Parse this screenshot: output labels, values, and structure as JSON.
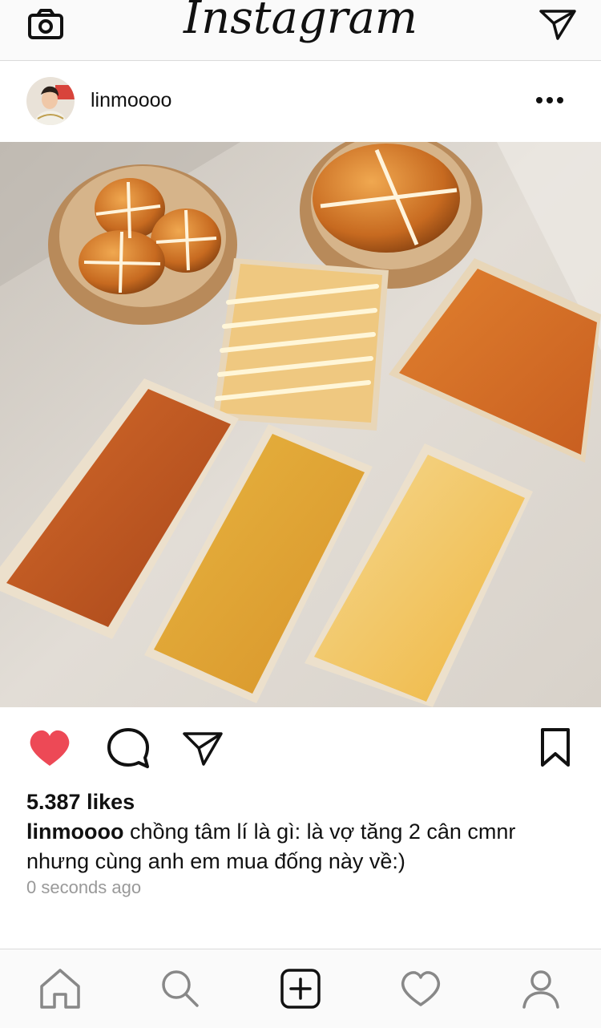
{
  "app": {
    "brand": "Instagram"
  },
  "icons": {
    "camera": "camera-icon",
    "direct": "paper-plane-icon",
    "more": "more-horizontal-icon",
    "like": "heart-icon",
    "comment": "comment-icon",
    "share": "paper-plane-icon",
    "save": "bookmark-icon",
    "home": "home-icon",
    "search": "search-icon",
    "add": "plus-square-icon",
    "activity": "heart-outline-icon",
    "profile": "person-icon"
  },
  "colors": {
    "like": "#ed4956",
    "muted": "#999999",
    "text": "#111111",
    "bar": "#fafafa",
    "divider": "#dbdbdb"
  },
  "post": {
    "username": "linmoooo",
    "likes": "5.387 likes",
    "caption_user": "linmoooo",
    "caption_text": " chồng tâm lí là gì: là vợ tăng 2 cân cmnr nhưng cùng anh em mua đống này về:)",
    "timestamp": "0 seconds ago",
    "liked": true
  }
}
